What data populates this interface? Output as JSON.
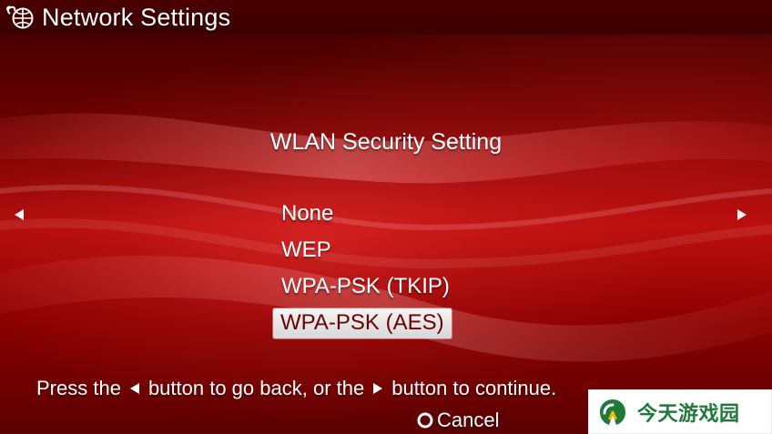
{
  "header": {
    "title": "Network Settings",
    "icon": "network-globe-icon"
  },
  "dialog": {
    "title": "WLAN Security Setting",
    "options": [
      {
        "label": "None",
        "selected": false
      },
      {
        "label": "WEP",
        "selected": false
      },
      {
        "label": "WPA-PSK (TKIP)",
        "selected": false
      },
      {
        "label": "WPA-PSK (AES)",
        "selected": true
      }
    ]
  },
  "footer": {
    "instructions_before": "Press the",
    "instructions_middle": "button to go back, or the",
    "instructions_after": "button to continue.",
    "cancel_label": "Cancel"
  },
  "watermark": {
    "text": "今天游戏园"
  },
  "colors": {
    "background_red": "#b10b0b",
    "header_dark": "#3a0000",
    "selected_text": "#6b0000",
    "watermark_green": "#1f7a3a"
  }
}
